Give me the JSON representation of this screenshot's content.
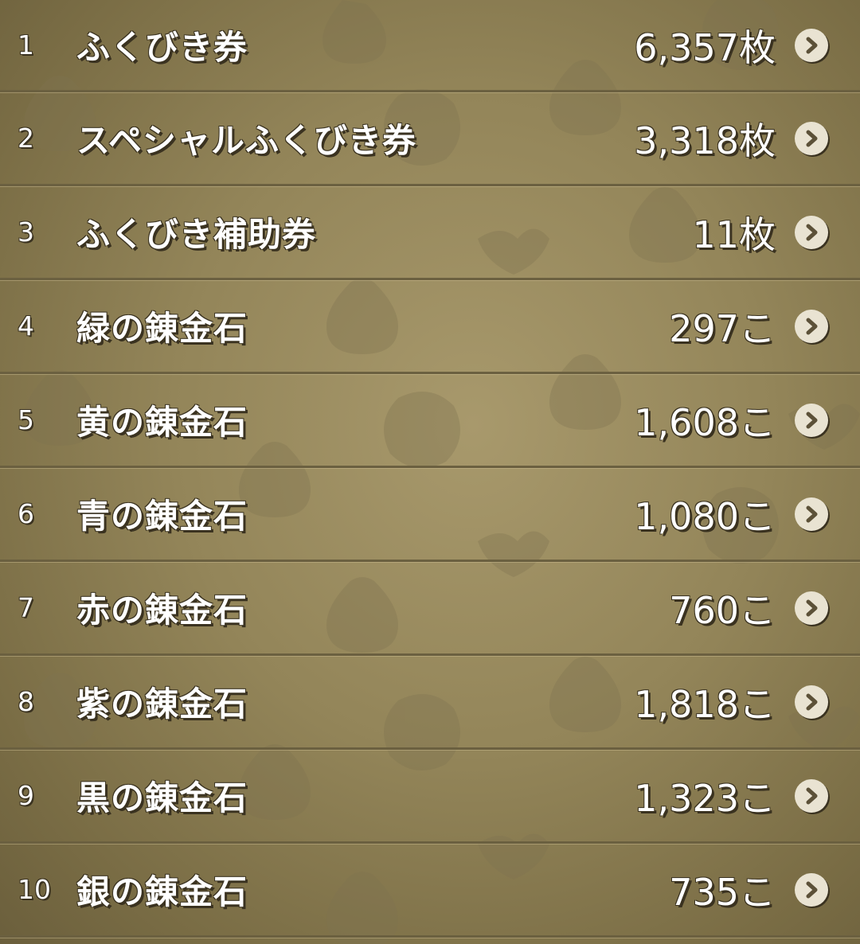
{
  "inventory": {
    "items": [
      {
        "index": "1",
        "name": "ふくびき券",
        "quantity": "6,357枚"
      },
      {
        "index": "2",
        "name": "スペシャルふくびき券",
        "quantity": "3,318枚"
      },
      {
        "index": "3",
        "name": "ふくびき補助券",
        "quantity": "11枚"
      },
      {
        "index": "4",
        "name": "緑の錬金石",
        "quantity": "297こ"
      },
      {
        "index": "5",
        "name": "黄の錬金石",
        "quantity": "1,608こ"
      },
      {
        "index": "6",
        "name": "青の錬金石",
        "quantity": "1,080こ"
      },
      {
        "index": "7",
        "name": "赤の錬金石",
        "quantity": "760こ"
      },
      {
        "index": "8",
        "name": "紫の錬金石",
        "quantity": "1,818こ"
      },
      {
        "index": "9",
        "name": "黒の錬金石",
        "quantity": "1,323こ"
      },
      {
        "index": "10",
        "name": "銀の錬金石",
        "quantity": "735こ"
      }
    ],
    "row_icon": "chevron-right-icon"
  },
  "theme": {
    "background": "#938559",
    "divider": "#6b6040",
    "text": "#ffffff",
    "text_outline": "#3a3220",
    "chevron_bg": "#e9e3d2",
    "chevron_fg": "#5c5138"
  }
}
